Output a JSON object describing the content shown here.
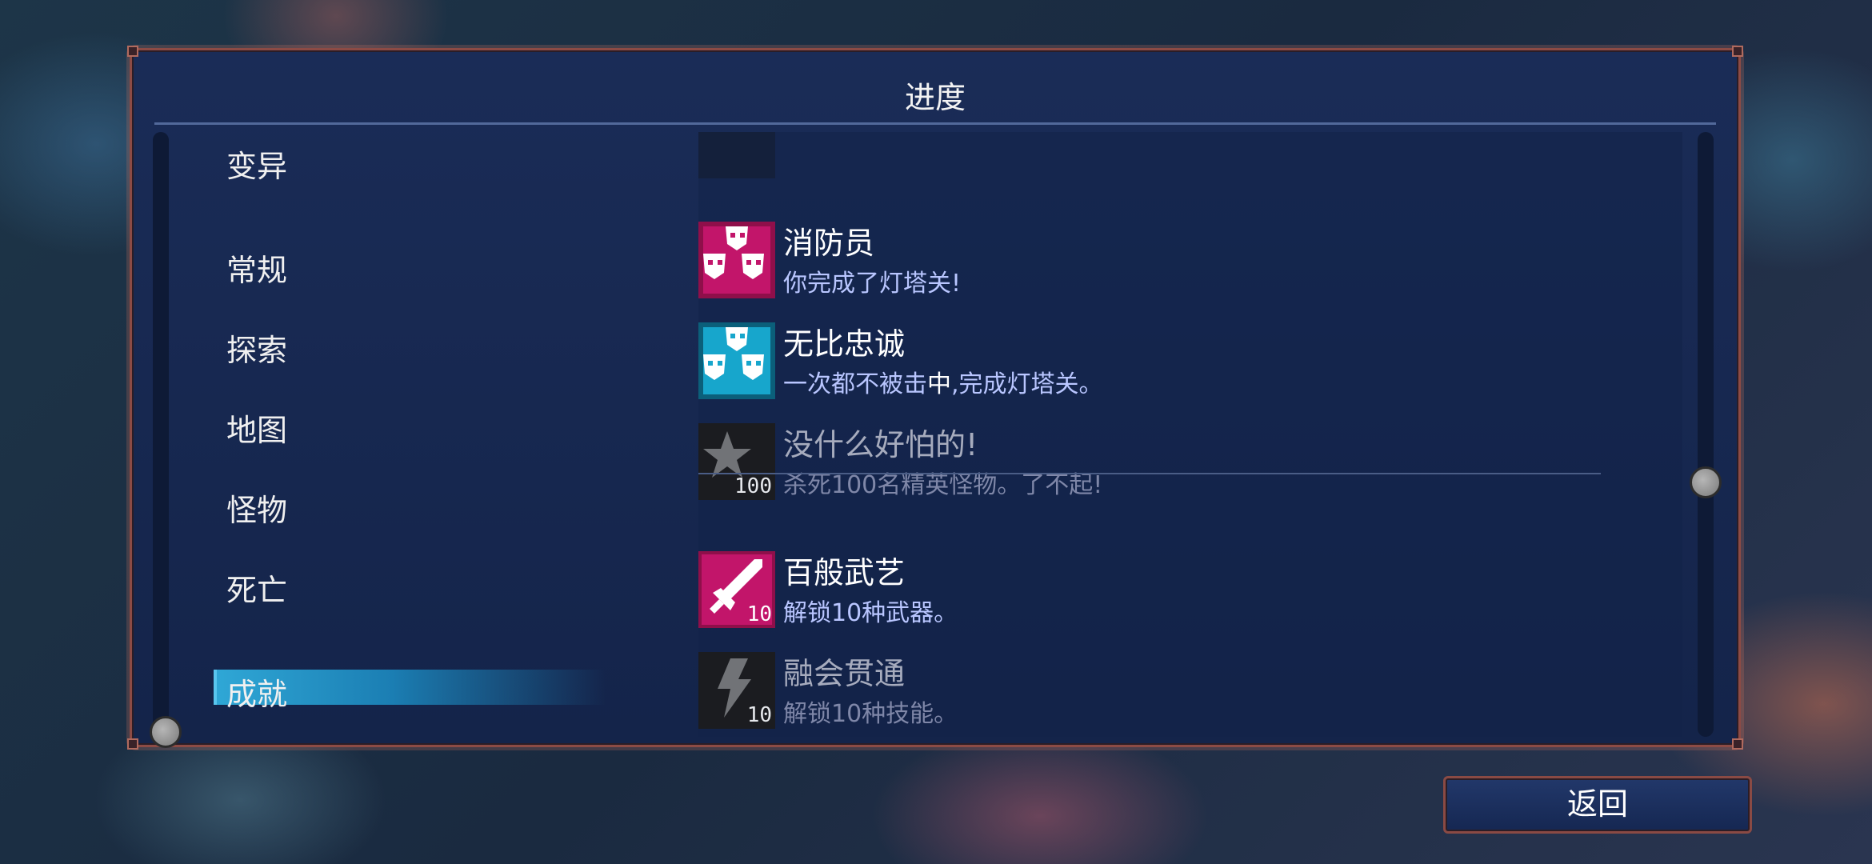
{
  "title": "进度",
  "categories": [
    {
      "label": "变异",
      "active": false
    },
    {
      "label": "常规",
      "active": false
    },
    {
      "label": "探索",
      "active": false
    },
    {
      "label": "地图",
      "active": false
    },
    {
      "label": "怪物",
      "active": false
    },
    {
      "label": "死亡",
      "active": false
    },
    {
      "label": "成就",
      "active": true
    }
  ],
  "achievements": [
    {
      "title": "消防员",
      "desc": "你完成了灯塔关!",
      "icon": "mask-trio-pink-icon",
      "unlocked": true
    },
    {
      "title": "无比忠诚",
      "desc_pre": "一次都不被击",
      "desc_hl": "中",
      "desc_post": ",完成灯塔关。",
      "icon": "mask-trio-cyan-icon",
      "unlocked": true
    },
    {
      "title": "没什么好怕的!",
      "desc": "杀死100名精英怪物。了不起!",
      "icon": "star-icon",
      "icon_number": "100",
      "unlocked": false
    },
    {
      "title": "百般武艺",
      "desc": "解锁10种武器。",
      "icon": "sword-icon",
      "icon_number": "10",
      "unlocked": true
    },
    {
      "title": "融会贯通",
      "desc": "解锁10种技能。",
      "icon": "lightning-icon",
      "icon_number": "10",
      "unlocked": false
    },
    {
      "title": "???",
      "icon": "hidden-icon",
      "unlocked": false
    }
  ],
  "back_button": "返回",
  "colors": {
    "panel_border": "#8c4b45",
    "accent_pink": "#e0197b",
    "accent_cyan": "#22c2e6",
    "active_tab": "#2fa7d6"
  }
}
